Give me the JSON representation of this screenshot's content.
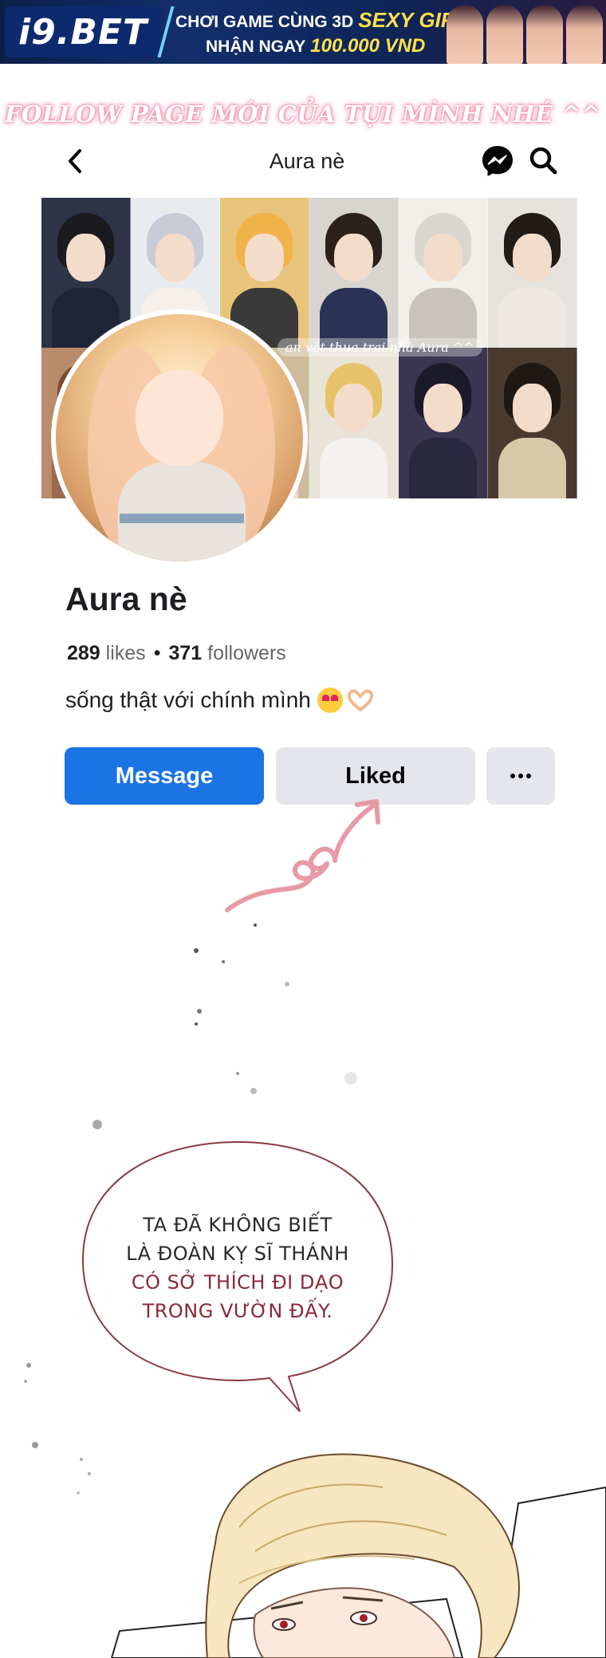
{
  "ad": {
    "brand": "i9.BET",
    "line1": "CHƠI GAME CÙNG 3D",
    "line1_highlight": "SEXY GIRL",
    "line2": "NHẬN NGAY",
    "line2_highlight": "100.000 VND"
  },
  "follow_banner": "FOLLOW PAGE MỚI CỦA TỤI MÌNH NHÉ ^^",
  "header": {
    "title": "Aura nè",
    "back_icon": "chevron-left-icon",
    "messenger_icon": "messenger-icon",
    "search_icon": "search-icon"
  },
  "cover": {
    "caption": "an vật thua trai nhà Aura ^^"
  },
  "profile": {
    "name": "Aura nè",
    "likes_count": "289",
    "likes_label": "likes",
    "dot": "•",
    "followers_count": "371",
    "followers_label": "followers",
    "bio": "sống thật với chính mình"
  },
  "buttons": {
    "message": "Message",
    "liked": "Liked",
    "more_icon": "more-horizontal-icon"
  },
  "speech_bubble": {
    "line1": "TA ĐÃ KHÔNG BIẾT",
    "line2": "LÀ ĐOÀN KỴ SĨ THÁNH",
    "line3": "CÓ SỞ THÍCH ĐI DẠO",
    "line4": "TRONG VƯỜN ĐẤY."
  },
  "colors": {
    "facebook_blue": "#1b74e4",
    "button_gray": "#e4e6eb",
    "follow_glow": "#f08aa7",
    "doodle_pink": "#e79aa6",
    "bubble_accent": "#8a2a36"
  }
}
